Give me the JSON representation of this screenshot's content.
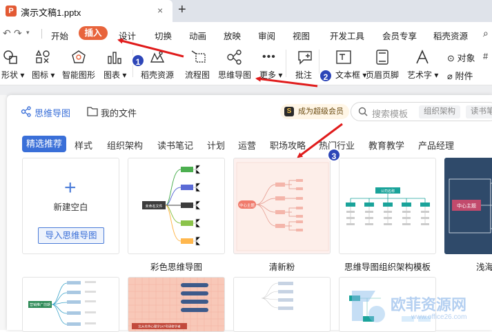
{
  "window": {
    "doc_title": "演示文稿1.pptx",
    "doc_icon_letter": "P",
    "close_glyph": "×",
    "new_tab_glyph": "+"
  },
  "ribbon_tabs": [
    "开始",
    "插入",
    "设计",
    "切换",
    "动画",
    "放映",
    "审阅",
    "视图",
    "开发工具",
    "会员专享",
    "稻壳资源"
  ],
  "toolbar": {
    "items": [
      "形状",
      "图标",
      "智能图形",
      "图表",
      "稻壳资源",
      "流程图",
      "思维导图",
      "更多",
      "批注",
      "文本框",
      "页眉页脚",
      "艺术字"
    ],
    "extra_top": "对象",
    "extra_bottom": "附件"
  },
  "panel": {
    "nav_mindmap": "思维导图",
    "nav_myfiles": "我的文件",
    "vip_label": "成为超级会员",
    "vip_icon_letter": "S",
    "search_placeholder": "搜索模板",
    "search_chips": [
      "组织架构",
      "读书笔记"
    ],
    "categories": [
      "精选推荐",
      "样式",
      "组织架构",
      "读书笔记",
      "计划",
      "运营",
      "职场攻略",
      "热门行业",
      "教育教学",
      "产品经理"
    ],
    "new_blank": "新建空白",
    "import_btn": "导入思维导图",
    "templates": [
      "彩色思维导图",
      "清新粉",
      "思维导图组织架构模板",
      "浅海"
    ],
    "thumb_texts": {
      "colorful_center": "未命名文件",
      "pink_center": "中心主题",
      "org_top": "公司名称",
      "navy_center": "中心主题",
      "row2_green": "营销推广前期",
      "row2_salmon": "北大光华心理学247号研修学者"
    }
  },
  "callouts": [
    "1",
    "2",
    "3"
  ],
  "watermark": {
    "text": "欧菲资源网",
    "sub": "www.office26.com"
  },
  "colors": {
    "accent_orange": "#e8643c",
    "accent_blue": "#3a6fd8",
    "callout_blue": "#2d46b8",
    "arrow_red": "#e01b1b"
  }
}
